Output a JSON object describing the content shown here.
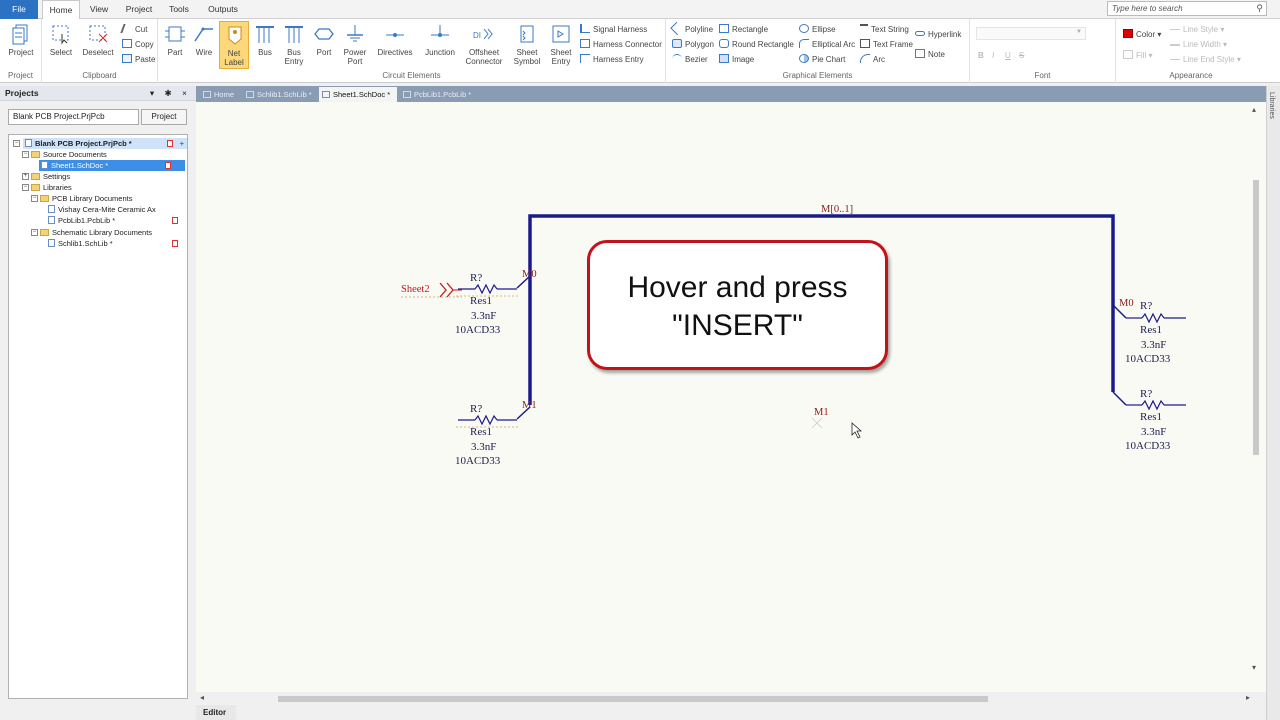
{
  "menu": {
    "file": "File",
    "home": "Home",
    "view": "View",
    "project": "Project",
    "tools": "Tools",
    "outputs": "Outputs"
  },
  "search": {
    "placeholder": "Type here to search"
  },
  "ribbon": {
    "project_group": "Project",
    "project_btn": "Project",
    "clipboard_group": "Clipboard",
    "select": "Select",
    "deselect": "Deselect",
    "cut": "Cut",
    "copy": "Copy",
    "paste": "Paste",
    "circuit_group": "Circuit Elements",
    "part": "Part",
    "wire": "Wire",
    "net_label_line1": "Net",
    "net_label_line2": "Label",
    "bus": "Bus",
    "bus_entry_line1": "Bus",
    "bus_entry_line2": "Entry",
    "port": "Port",
    "power_port_line1": "Power",
    "power_port_line2": "Port",
    "directives": "Directives",
    "junction": "Junction",
    "offsheet_line1": "Offsheet",
    "offsheet_line2": "Connector",
    "sheet_symbol_line1": "Sheet",
    "sheet_symbol_line2": "Symbol",
    "sheet_entry_line1": "Sheet",
    "sheet_entry_line2": "Entry",
    "signal_harness": "Signal Harness",
    "harness_connector": "Harness Connector",
    "harness_entry": "Harness Entry",
    "graphical_group": "Graphical Elements",
    "polyline": "Polyline",
    "polygon": "Polygon",
    "bezier": "Bezier",
    "rectangle": "Rectangle",
    "round_rectangle": "Round Rectangle",
    "image": "Image",
    "ellipse": "Ellipse",
    "elliptical_arc": "Elliptical Arc",
    "pie_chart": "Pie Chart",
    "text_string": "Text String",
    "text_frame": "Text Frame",
    "arc": "Arc",
    "hyperlink": "Hyperlink",
    "note": "Note",
    "font_group": "Font",
    "bold": "B",
    "italic": "I",
    "underline": "U",
    "strike": "S",
    "appearance_group": "Appearance",
    "color": "Color",
    "fill": "Fill",
    "line_style": "Line Style",
    "line_width": "Line Width",
    "line_end_style": "Line End Style"
  },
  "panel": {
    "title": "Projects",
    "controls": "▾ ✱ ×",
    "project_field": "Blank PCB Project.PrjPcb",
    "project_button": "Project",
    "tree": {
      "root": "Blank PCB Project.PrjPcb *",
      "source_docs": "Source Documents",
      "sheet1": "Sheet1.SchDoc *",
      "settings": "Settings",
      "libraries": "Libraries",
      "pcb_lib_docs": "PCB Library Documents",
      "vishay": "Vishay Cera-Mite Ceramic Ax",
      "pcblib": "PcbLib1.PcbLib *",
      "sch_lib_docs": "Schematic Library Documents",
      "schlib": "Schlib1.SchLib *"
    }
  },
  "doc_tabs": [
    {
      "label": "Home"
    },
    {
      "label": "Schlib1.SchLib *"
    },
    {
      "label": "Sheet1.SchDoc *"
    },
    {
      "label": "PcbLib1.PcbLib *"
    }
  ],
  "editor_tab": "Editor",
  "right_strip": "Libraries",
  "schematic": {
    "bus_label": "M[0..1]",
    "port_name": "Sheet2",
    "left_top": {
      "net": "M0",
      "des": "R?",
      "comment": "Res1",
      "value": "3.3nF",
      "part": "10ACD33"
    },
    "left_bottom": {
      "net": "M1",
      "des": "R?",
      "comment": "Res1",
      "value": "3.3nF",
      "part": "10ACD33"
    },
    "right_top": {
      "net": "M0",
      "des": "R?",
      "comment": "Res1",
      "value": "3.3nF",
      "part": "10ACD33"
    },
    "right_bottom": {
      "des": "R?",
      "comment": "Res1",
      "value": "3.3nF",
      "part": "10ACD33"
    },
    "floating_label": "M1"
  },
  "callout": {
    "line1": "Hover and press",
    "line2": "\"INSERT\""
  },
  "colors": {
    "bus": "#1a1a8c",
    "wire": "#1a1a8c",
    "label": "#8b1a1a",
    "callout_border": "#c0141a",
    "file_tab": "#2b72c5"
  }
}
